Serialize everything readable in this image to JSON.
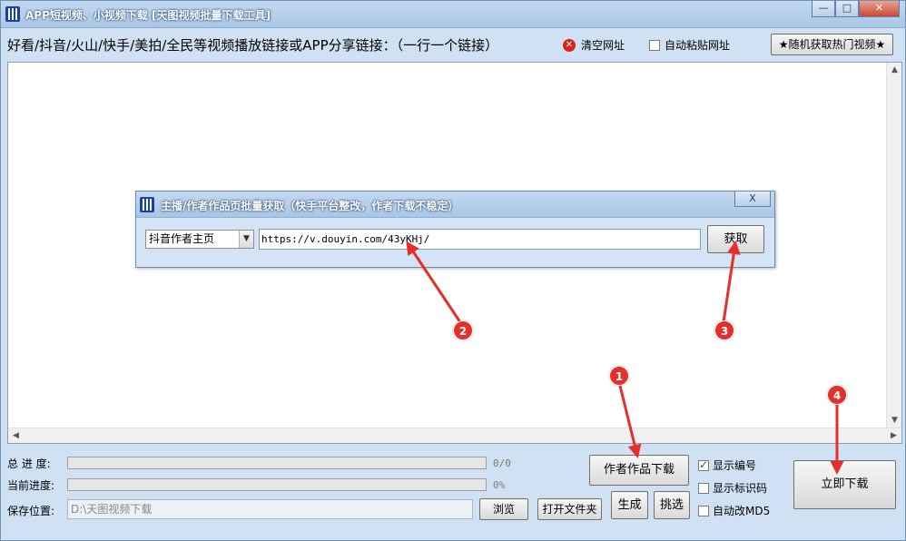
{
  "window": {
    "title": "APP短视频、小视频下载 [天图视频批量下载工具]",
    "controls": {
      "minimize": "—",
      "maximize": "□",
      "close": "✕"
    }
  },
  "toolbar": {
    "instruction": "好看/抖音/火山/快手/美拍/全民等视频播放链接或APP分享链接：（一行一个链接）",
    "clear_label": "清空网址",
    "autopaste_label": "自动粘贴网址",
    "autopaste_checked": false,
    "random_button": "★随机获取热门视频★"
  },
  "url_box": {
    "value": ""
  },
  "dialog": {
    "title": "主播/作者作品页批量获取（快手平台整改，作者下载不稳定）",
    "close": "X",
    "source_select": "抖音作者主页",
    "url_value": "https://v.douyin.com/43yKHj/",
    "fetch_button": "获取"
  },
  "progress": {
    "total_label": "总 进 度:",
    "total_value": "0/0",
    "total_fraction": 0,
    "current_label": "当前进度:",
    "current_value": "0%",
    "current_fraction": 0
  },
  "save": {
    "label": "保存位置:",
    "path": "D:\\天图视频下载",
    "browse_button": "浏览",
    "open_folder_button": "打开文件夹"
  },
  "actions": {
    "author_download": "作者作品下载",
    "generate": "生成",
    "pick": "挑选",
    "download_now": "立即下载"
  },
  "options": {
    "show_number": {
      "label": "显示编号",
      "checked": true
    },
    "show_id": {
      "label": "显示标识码",
      "checked": false
    },
    "auto_md5": {
      "label": "自动改MD5",
      "checked": false
    }
  },
  "annotations": [
    "1",
    "2",
    "3",
    "4"
  ],
  "colors": {
    "marker": "#e3302b",
    "progress_fill": "#37a33f",
    "clear_icon": "#d9231b"
  }
}
